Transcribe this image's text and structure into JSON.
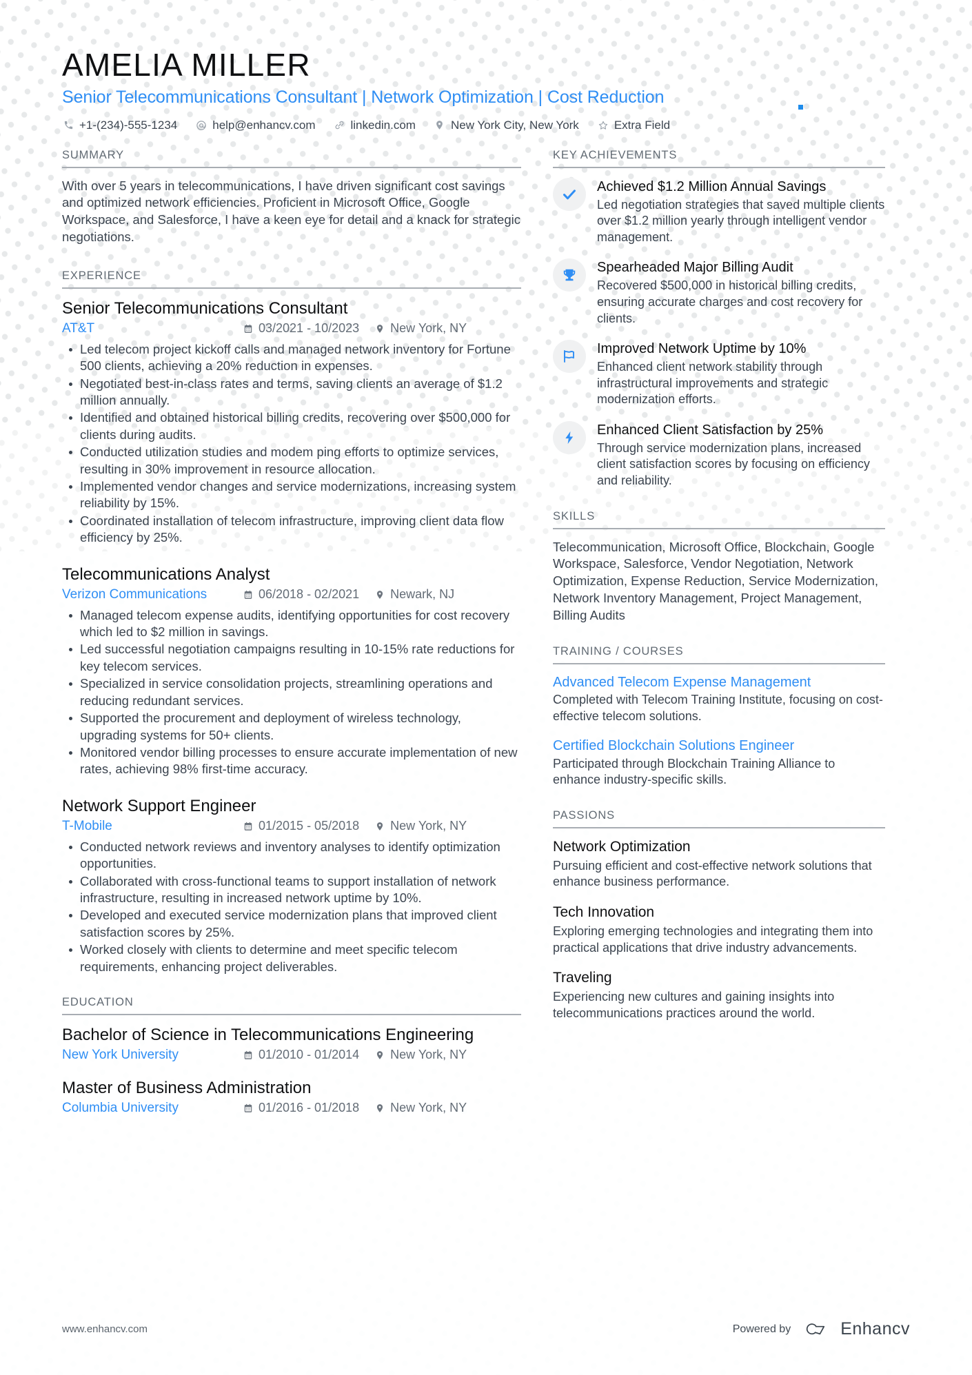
{
  "colors": {
    "accent": "#2f8ef4",
    "name": "#0f1012",
    "body_text": "#3c4550",
    "muted": "#616a73",
    "rule": "#a8adb3",
    "badge_bg": "#f0f1f2",
    "dot": "#e7e9ea",
    "marker": "#1f8ceb"
  },
  "header": {
    "name": "AMELIA MILLER",
    "headline": "Senior Telecommunications Consultant | Network Optimization | Cost Reduction",
    "contacts": [
      {
        "icon": "phone-icon",
        "text": "+1-(234)-555-1234"
      },
      {
        "icon": "email-icon",
        "text": "help@enhancv.com"
      },
      {
        "icon": "link-icon",
        "text": "linkedin.com"
      },
      {
        "icon": "location-icon",
        "text": "New York City, New York"
      },
      {
        "icon": "star-icon",
        "text": "Extra Field"
      }
    ]
  },
  "summary": {
    "heading": "SUMMARY",
    "text": "With over 5 years in telecommunications, I have driven significant cost savings and optimized network efficiencies. Proficient in Microsoft Office, Google Workspace, and Salesforce, I have a keen eye for detail and a knack for strategic negotiations."
  },
  "experience": {
    "heading": "EXPERIENCE",
    "entries": [
      {
        "title": "Senior Telecommunications Consultant",
        "org": "AT&T",
        "dates": "03/2021 - 10/2023",
        "location": "New York, NY",
        "bullets": [
          "Led telecom project kickoff calls and managed network inventory for Fortune 500 clients, achieving a 20% reduction in expenses.",
          "Negotiated best-in-class rates and terms, saving clients an average of $1.2 million annually.",
          "Identified and obtained historical billing credits, recovering over $500,000 for clients during audits.",
          "Conducted utilization studies and modem ping efforts to optimize services, resulting in 30% improvement in resource allocation.",
          "Implemented vendor changes and service modernizations, increasing system reliability by 15%.",
          "Coordinated installation of telecom infrastructure, improving client data flow efficiency by 25%."
        ]
      },
      {
        "title": "Telecommunications Analyst",
        "org": "Verizon Communications",
        "dates": "06/2018 - 02/2021",
        "location": "Newark, NJ",
        "bullets": [
          "Managed telecom expense audits, identifying opportunities for cost recovery which led to $2 million in savings.",
          "Led successful negotiation campaigns resulting in 10-15% rate reductions for key telecom services.",
          "Specialized in service consolidation projects, streamlining operations and reducing redundant services.",
          "Supported the procurement and deployment of wireless technology, upgrading systems for 50+ clients.",
          "Monitored vendor billing processes to ensure accurate implementation of new rates, achieving 98% first-time accuracy."
        ]
      },
      {
        "title": "Network Support Engineer",
        "org": "T-Mobile",
        "dates": "01/2015 - 05/2018",
        "location": "New York, NY",
        "bullets": [
          "Conducted network reviews and inventory analyses to identify optimization opportunities.",
          "Collaborated with cross-functional teams to support installation of network infrastructure, resulting in increased network uptime by 10%.",
          "Developed and executed service modernization plans that improved client satisfaction scores by 25%.",
          "Worked closely with clients to determine and meet specific telecom requirements, enhancing project deliverables."
        ]
      }
    ]
  },
  "education": {
    "heading": "EDUCATION",
    "entries": [
      {
        "title": "Bachelor of Science in Telecommunications Engineering",
        "org": "New York University",
        "dates": "01/2010 - 01/2014",
        "location": "New York, NY"
      },
      {
        "title": "Master of Business Administration",
        "org": "Columbia University",
        "dates": "01/2016 - 01/2018",
        "location": "New York, NY"
      }
    ]
  },
  "key_achievements": {
    "heading": "KEY ACHIEVEMENTS",
    "items": [
      {
        "icon": "check-icon",
        "title": "Achieved $1.2 Million Annual Savings",
        "desc": "Led negotiation strategies that saved multiple clients over $1.2 million yearly through intelligent vendor management."
      },
      {
        "icon": "trophy-icon",
        "title": "Spearheaded Major Billing Audit",
        "desc": "Recovered $500,000 in historical billing credits, ensuring accurate charges and cost recovery for clients."
      },
      {
        "icon": "flag-icon",
        "title": "Improved Network Uptime by 10%",
        "desc": "Enhanced client network stability through infrastructural improvements and strategic modernization efforts."
      },
      {
        "icon": "bolt-icon",
        "title": "Enhanced Client Satisfaction by 25%",
        "desc": "Through service modernization plans, increased client satisfaction scores by focusing on efficiency and reliability."
      }
    ]
  },
  "skills": {
    "heading": "SKILLS",
    "text": "Telecommunication, Microsoft Office, Blockchain, Google Workspace, Salesforce, Vendor Negotiation, Network Optimization, Expense Reduction, Service Modernization, Network Inventory Management, Project Management, Billing Audits"
  },
  "training": {
    "heading": "TRAINING / COURSES",
    "items": [
      {
        "title": "Advanced Telecom Expense Management",
        "desc": "Completed with Telecom Training Institute, focusing on cost-effective telecom solutions."
      },
      {
        "title": "Certified Blockchain Solutions Engineer",
        "desc": "Participated through Blockchain Training Alliance to enhance industry-specific skills."
      }
    ]
  },
  "passions": {
    "heading": "PASSIONS",
    "items": [
      {
        "title": "Network Optimization",
        "desc": "Pursuing efficient and cost-effective network solutions that enhance business performance."
      },
      {
        "title": "Tech Innovation",
        "desc": "Exploring emerging technologies and integrating them into practical applications that drive industry advancements."
      },
      {
        "title": "Traveling",
        "desc": "Experiencing new cultures and gaining insights into telecommunications practices around the world."
      }
    ]
  },
  "footer": {
    "url": "www.enhancv.com",
    "powered_by": "Powered by",
    "brand": "Enhancv"
  }
}
